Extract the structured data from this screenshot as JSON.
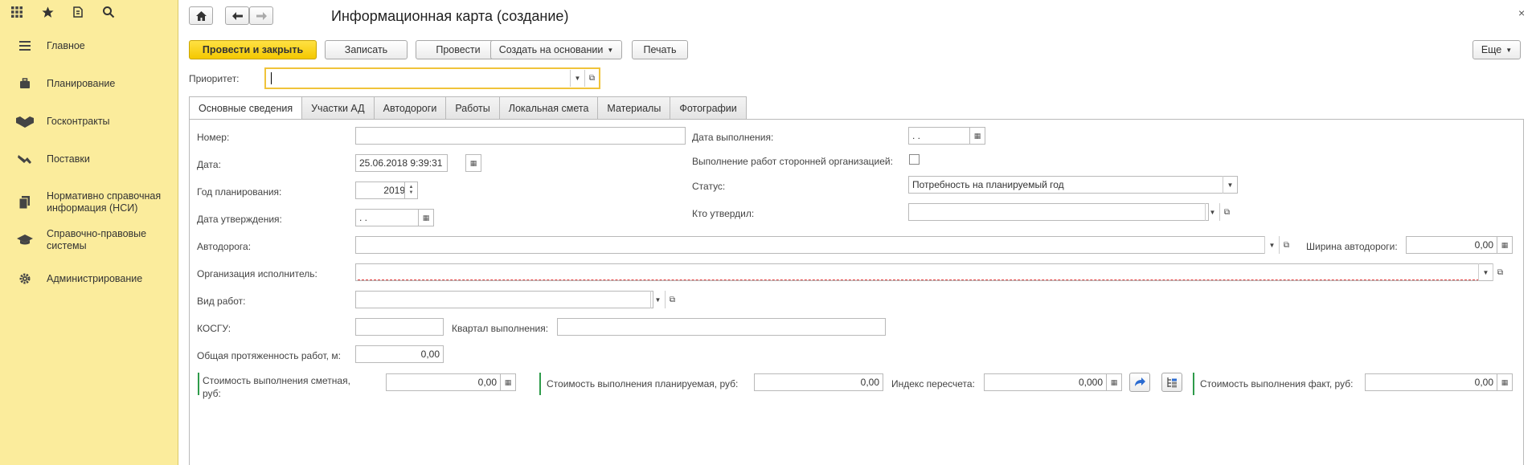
{
  "sidebar": {
    "top_icons": [
      "grid-icon",
      "star-icon",
      "history-icon",
      "search-icon"
    ],
    "items": [
      {
        "label": "Главное",
        "icon": "menu-icon"
      },
      {
        "label": "Планирование",
        "icon": "briefcase-icon"
      },
      {
        "label": "Госконтракты",
        "icon": "handshake-icon"
      },
      {
        "label": "Поставки",
        "icon": "truck-icon"
      },
      {
        "label": "Нормативно справочная информация (НСИ)",
        "icon": "documents-icon"
      },
      {
        "label": "Справочно-правовые системы",
        "icon": "graduation-cap-icon"
      },
      {
        "label": "Администрирование",
        "icon": "gear-icon"
      }
    ]
  },
  "header": {
    "title": "Информационная карта (создание)",
    "close": "×"
  },
  "toolbar": {
    "post_close": "Провести и закрыть",
    "save": "Записать",
    "post": "Провести",
    "create_based": "Создать на основании",
    "print": "Печать",
    "more": "Еще"
  },
  "priority": {
    "label": "Приоритет:",
    "value": ""
  },
  "tabs": [
    "Основные сведения",
    "Участки АД",
    "Автодороги",
    "Работы",
    "Локальная смета",
    "Материалы",
    "Фотографии"
  ],
  "form": {
    "number": {
      "label": "Номер:",
      "value": ""
    },
    "date": {
      "label": "Дата:",
      "value": "25.06.2018  9:39:31"
    },
    "plan_year": {
      "label": "Год планирования:",
      "value": "2019"
    },
    "approval_date": {
      "label": "Дата утверждения:",
      "value": " .  ."
    },
    "road": {
      "label": "Автодорога:",
      "value": ""
    },
    "executor": {
      "label": "Организация исполнитель:",
      "value": ""
    },
    "work_type": {
      "label": "Вид работ:",
      "value": ""
    },
    "kosgu": {
      "label": "КОСГУ:",
      "value": ""
    },
    "quarter": {
      "label": "Квартал выполнения:",
      "value": ""
    },
    "length": {
      "label": "Общая протяженность работ, м:",
      "value": "0,00"
    },
    "exec_date": {
      "label": "Дата выполнения:",
      "value": " .  ."
    },
    "third_party": {
      "label": "Выполнение работ сторонней организацией:"
    },
    "status": {
      "label": "Статус:",
      "value": "Потребность на планируемый год"
    },
    "approved_by": {
      "label": "Кто утвердил:",
      "value": ""
    },
    "road_width": {
      "label": "Ширина автодороги:",
      "value": "0,00"
    },
    "cost_estimate": {
      "label_line1": "Стоимость выполнения сметная,",
      "label_line2": "руб:",
      "value": "0,00"
    },
    "cost_planned": {
      "label": "Стоимость выполнения планируемая, руб:",
      "value": "0,00"
    },
    "recalc_index": {
      "label": "Индекс пересчета:",
      "value": "0,000"
    },
    "cost_fact": {
      "label": "Стоимость выполнения факт, руб:",
      "value": "0,00"
    }
  }
}
